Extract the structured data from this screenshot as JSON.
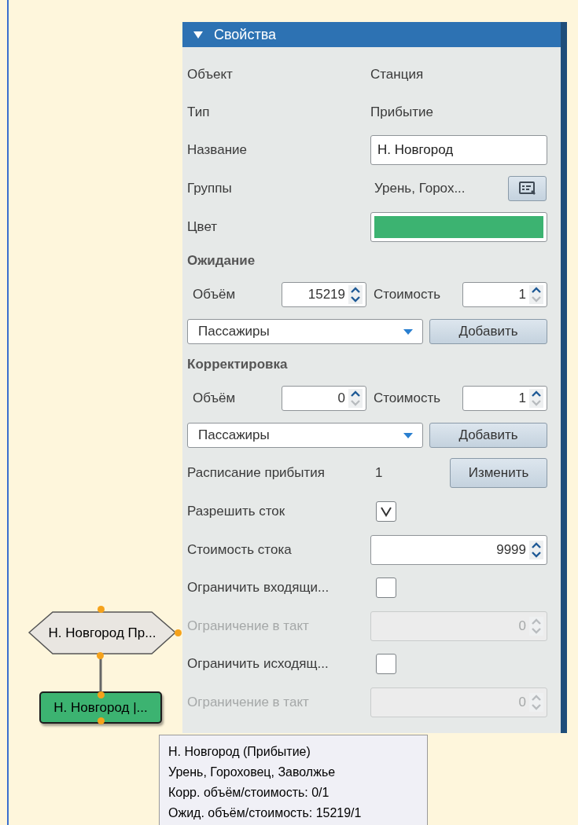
{
  "panel": {
    "title": "Свойства",
    "expanded": true,
    "rows": [
      {
        "kind": "text",
        "label": "Объект",
        "value": "Станция"
      },
      {
        "kind": "text",
        "label": "Тип",
        "value": "Прибытие"
      },
      {
        "kind": "input",
        "label": "Название",
        "value": "Н. Новгород"
      },
      {
        "kind": "groups",
        "label": "Группы",
        "value": "Урень, Горох..."
      },
      {
        "kind": "color",
        "label": "Цвет",
        "color": "#3cb371"
      },
      {
        "kind": "section",
        "label": "Ожидание"
      },
      {
        "kind": "spin-pair",
        "label": "Объём",
        "value": "15219",
        "can_increase": true,
        "can_decrease": true,
        "label_2": "Стоимость",
        "value_2": "1",
        "can_increase_2": true,
        "can_decrease_2": false
      },
      {
        "kind": "combo",
        "value": "Пассажиры",
        "button": "Добавить"
      },
      {
        "kind": "section",
        "label": "Корректировка"
      },
      {
        "kind": "spin-pair",
        "label": "Объём",
        "value": "0",
        "can_increase": true,
        "can_decrease": false,
        "label_2": "Стоимость",
        "value_2": "1",
        "can_increase_2": true,
        "can_decrease_2": false
      },
      {
        "kind": "combo",
        "value": "Пассажиры",
        "button": "Добавить"
      },
      {
        "kind": "schedule",
        "label": "Расписание прибытия",
        "value": "1",
        "button": "Изменить"
      },
      {
        "kind": "checkbox",
        "label": "Разрешить сток",
        "checked": true
      },
      {
        "kind": "spin",
        "label": "Стоимость стока",
        "value": "9999",
        "disabled": false,
        "can_increase": true,
        "can_decrease": true
      },
      {
        "kind": "checkbox",
        "label": "Ограничить входящи...",
        "checked": false
      },
      {
        "kind": "spin",
        "label": "Ограничение в такт",
        "value": "0",
        "disabled": true,
        "can_increase": false,
        "can_decrease": false
      },
      {
        "kind": "checkbox",
        "label": "Ограничить исходящ...",
        "checked": false
      },
      {
        "kind": "spin",
        "label": "Ограничение в такт",
        "value": "0",
        "disabled": true,
        "can_increase": false,
        "can_decrease": false
      }
    ]
  },
  "canvas": {
    "nodes": [
      {
        "kind": "hexagon",
        "label": "Н. Новгород Пр...",
        "color": "#e9e6e1"
      },
      {
        "kind": "rect",
        "label": "Н. Новгород |...",
        "color": "#3cb371"
      }
    ]
  },
  "tooltip": {
    "lines": [
      "Н. Новгород (Прибытие)",
      "Урень, Гороховец, Заволжье",
      "Корр. объём/стоимость: 0/1",
      "Ожид. объём/стоимость: 15219/1"
    ]
  }
}
